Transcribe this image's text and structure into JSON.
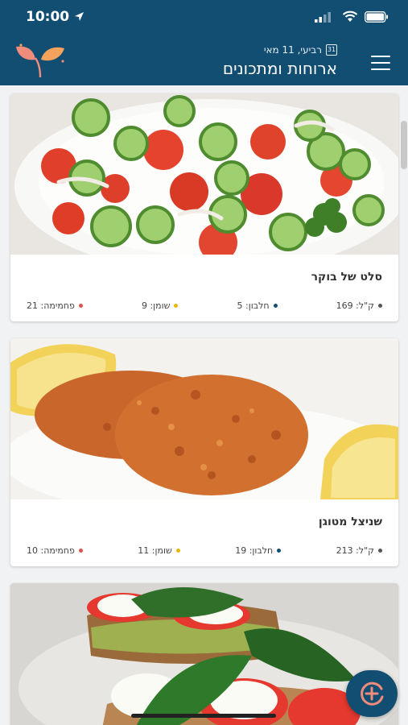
{
  "status_bar": {
    "time": "10:00"
  },
  "header": {
    "date": "רביעי, 11 מאי",
    "calendar_day": "31",
    "title": "ארוחות ומתכונים"
  },
  "recipes": [
    {
      "name": "סלט של בוקר",
      "nutrition": [
        {
          "label": "ק\"ל: 169",
          "color": "#555555"
        },
        {
          "label": "חלבון: 5",
          "color": "#124d72"
        },
        {
          "label": "שומן: 9",
          "color": "#e6b800"
        },
        {
          "label": "פחמימה: 21",
          "color": "#d9534f"
        }
      ]
    },
    {
      "name": "שניצל מטוגן",
      "nutrition": [
        {
          "label": "ק\"ל: 213",
          "color": "#555555"
        },
        {
          "label": "חלבון: 19",
          "color": "#124d72"
        },
        {
          "label": "שומן: 11",
          "color": "#e6b800"
        },
        {
          "label": "פחמימה: 10",
          "color": "#d9534f"
        }
      ]
    }
  ],
  "colors": {
    "header": "#124d72",
    "background": "#f1f2f4"
  }
}
